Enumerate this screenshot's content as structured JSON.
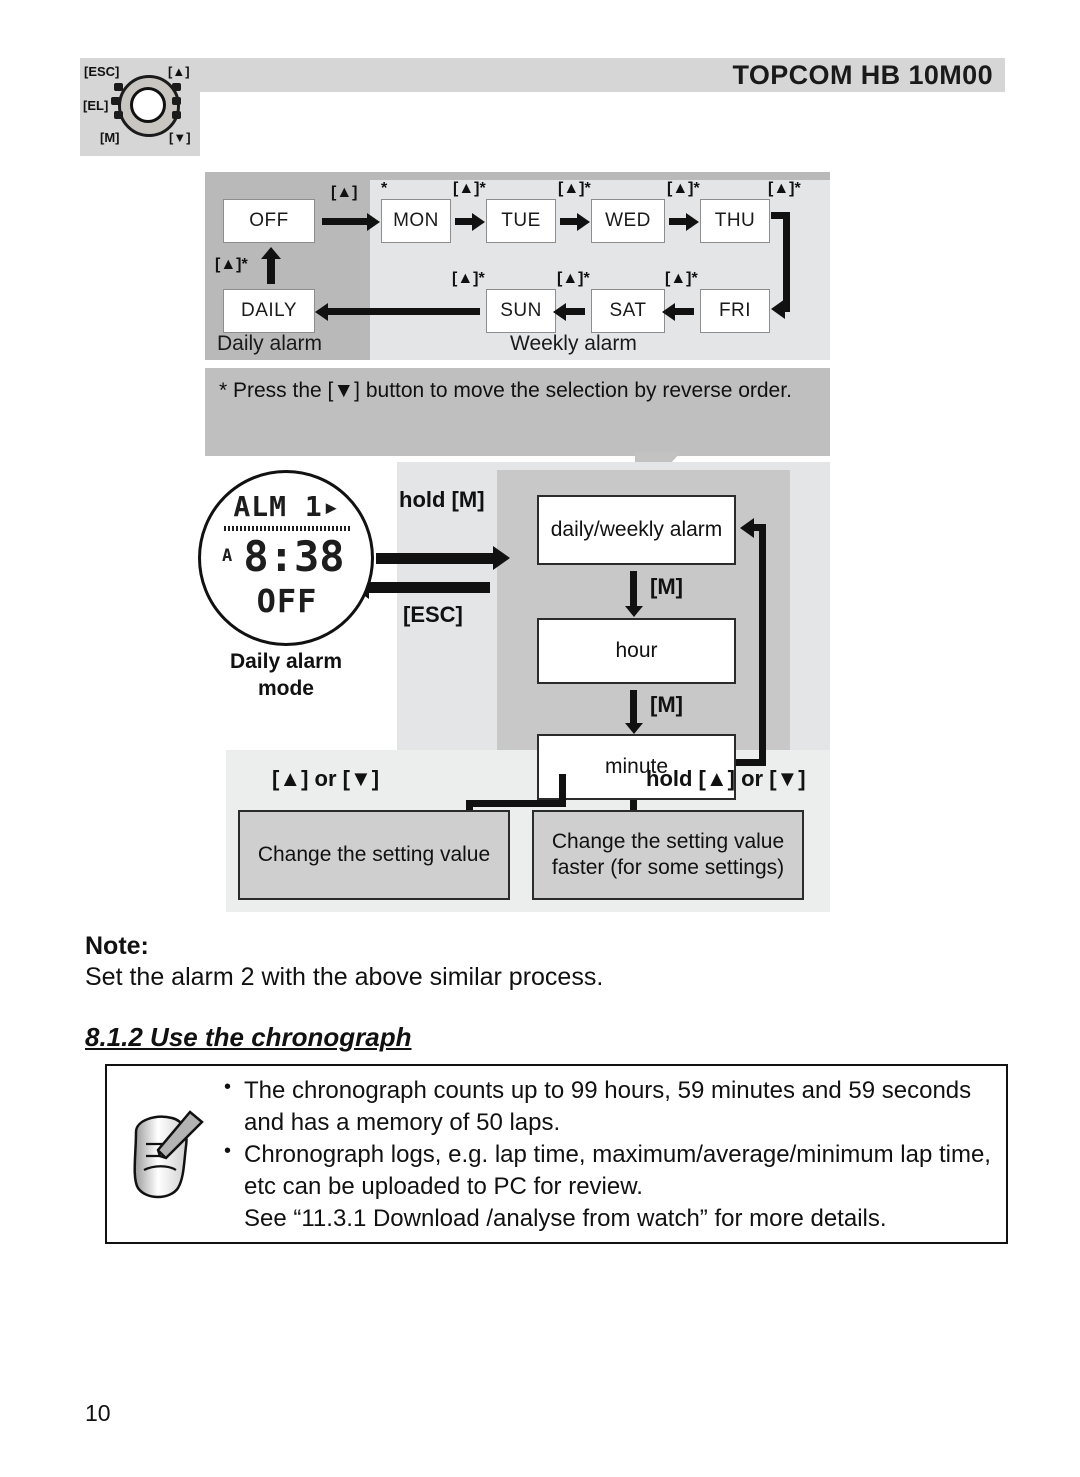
{
  "header": {
    "title": "TOPCOM HB 10M00"
  },
  "watch_keymap": {
    "esc": "[ESC]",
    "el": "[EL]",
    "m": "[M]",
    "up": "[▲]",
    "down": "[▼]"
  },
  "alarm_cycle": {
    "off_label": "OFF",
    "daily_label": "DAILY",
    "days": [
      "MON",
      "TUE",
      "WED",
      "THU",
      "FRI",
      "SAT",
      "SUN"
    ],
    "zone_daily": "Daily alarm",
    "zone_weekly": "Weekly alarm",
    "tag_up": "[▲]",
    "tag_up_star": "[▲]*",
    "star": "*"
  },
  "reverse_note": {
    "text": "* Press the [▼] button to move the selection by reverse order."
  },
  "lcd": {
    "line1": "ALM 1",
    "marker": "▸",
    "indicator": "A",
    "time": "8:38",
    "line3": "OFF",
    "caption_line1": "Daily alarm",
    "caption_line2": "mode"
  },
  "setting_flow": {
    "enter_label": "hold [M]",
    "exit_label": "[ESC]",
    "step_alarm": "daily/weekly alarm",
    "step_hour": "hour",
    "step_minute": "minute",
    "m_tag": "[M]",
    "change_tag": "[▲] or [▼]",
    "change_fast_tag": "hold [▲] or [▼]",
    "change_box": "Change the setting value",
    "change_fast_box": "Change the setting value faster (for some settings)"
  },
  "note": {
    "label": "Note:",
    "text": "Set the alarm 2 with the above similar process."
  },
  "section": {
    "heading": "8.1.2 Use the chronograph"
  },
  "chronograph": {
    "bullet1": "The chronograph counts up to 99 hours, 59 minutes and 59 seconds and has a memory of 50 laps.",
    "bullet2": "Chronograph logs, e.g. lap time, maximum/average/minimum lap time, etc can be uploaded to PC for review.",
    "extra_line": "See “11.3.1 Download /analyse from watch” for more details."
  },
  "footer": {
    "page_number": "10"
  },
  "colors": {
    "header_bar": "#d6d6d6",
    "daily_zone": "#b9b9b9",
    "weekly_zone": "#e3e5e6",
    "callout": "#bfbfbf",
    "gray_box": "#cfcfcf",
    "ink": "#111111"
  }
}
